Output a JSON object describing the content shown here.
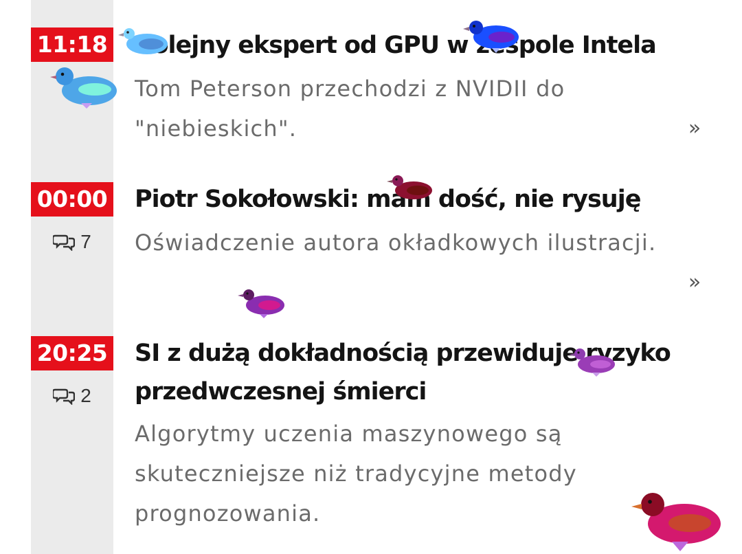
{
  "articles": [
    {
      "time": "11:18",
      "title": "Kolejny ekspert od GPU w zespole Intela",
      "lead": "Tom Peterson przechodzi z NVIDII do \"niebieskich\".",
      "more": "»"
    },
    {
      "time": "00:00",
      "title": "Piotr Sokołowski: mam dość, nie rysuję",
      "lead": "Oświadczenie autora okładkowych ilustracji.",
      "comments": "7",
      "more": "»"
    },
    {
      "time": "20:25",
      "title": "SI z dużą dokładnością przewiduje ryzyko przedwczesnej śmierci",
      "lead": "Algorytmy uczenia maszynowego są skuteczniejsze niż tradycyjne metody prognozowania.",
      "comments": "2"
    }
  ],
  "colors": {
    "time_badge": "#e5101b",
    "timeline_rail": "#ebebeb",
    "headline": "#141414",
    "lead": "#6b6b6b"
  },
  "icons": {
    "comments": "speech-bubbles-icon",
    "more": "double-chevron-right"
  },
  "overlay_birds": [
    {
      "name": "light-blue-bird",
      "color": "#66bfff",
      "head": "#7ed4ff",
      "accent": "#4f8fd9"
    },
    {
      "name": "blue-bird",
      "color": "#1a4fff",
      "head": "#1133cc",
      "accent": "#6a22cc"
    },
    {
      "name": "cyan-blue-bird",
      "color": "#4ea6e8",
      "head": "#3d94e0",
      "accent": "#7ff2dd"
    },
    {
      "name": "maroon-bird",
      "color": "#8c1030",
      "head": "#8a1a56",
      "accent": "#6e1010"
    },
    {
      "name": "purple-bird",
      "color": "#8a2db0",
      "head": "#5d1c62",
      "accent": "#d21a8f"
    },
    {
      "name": "violet-bird",
      "color": "#9a3db6",
      "head": "#8f3db0",
      "accent": "#c05fd5"
    },
    {
      "name": "crimson-bird",
      "color": "#d4196e",
      "head": "#8b0c25",
      "accent": "#c8452e"
    }
  ]
}
